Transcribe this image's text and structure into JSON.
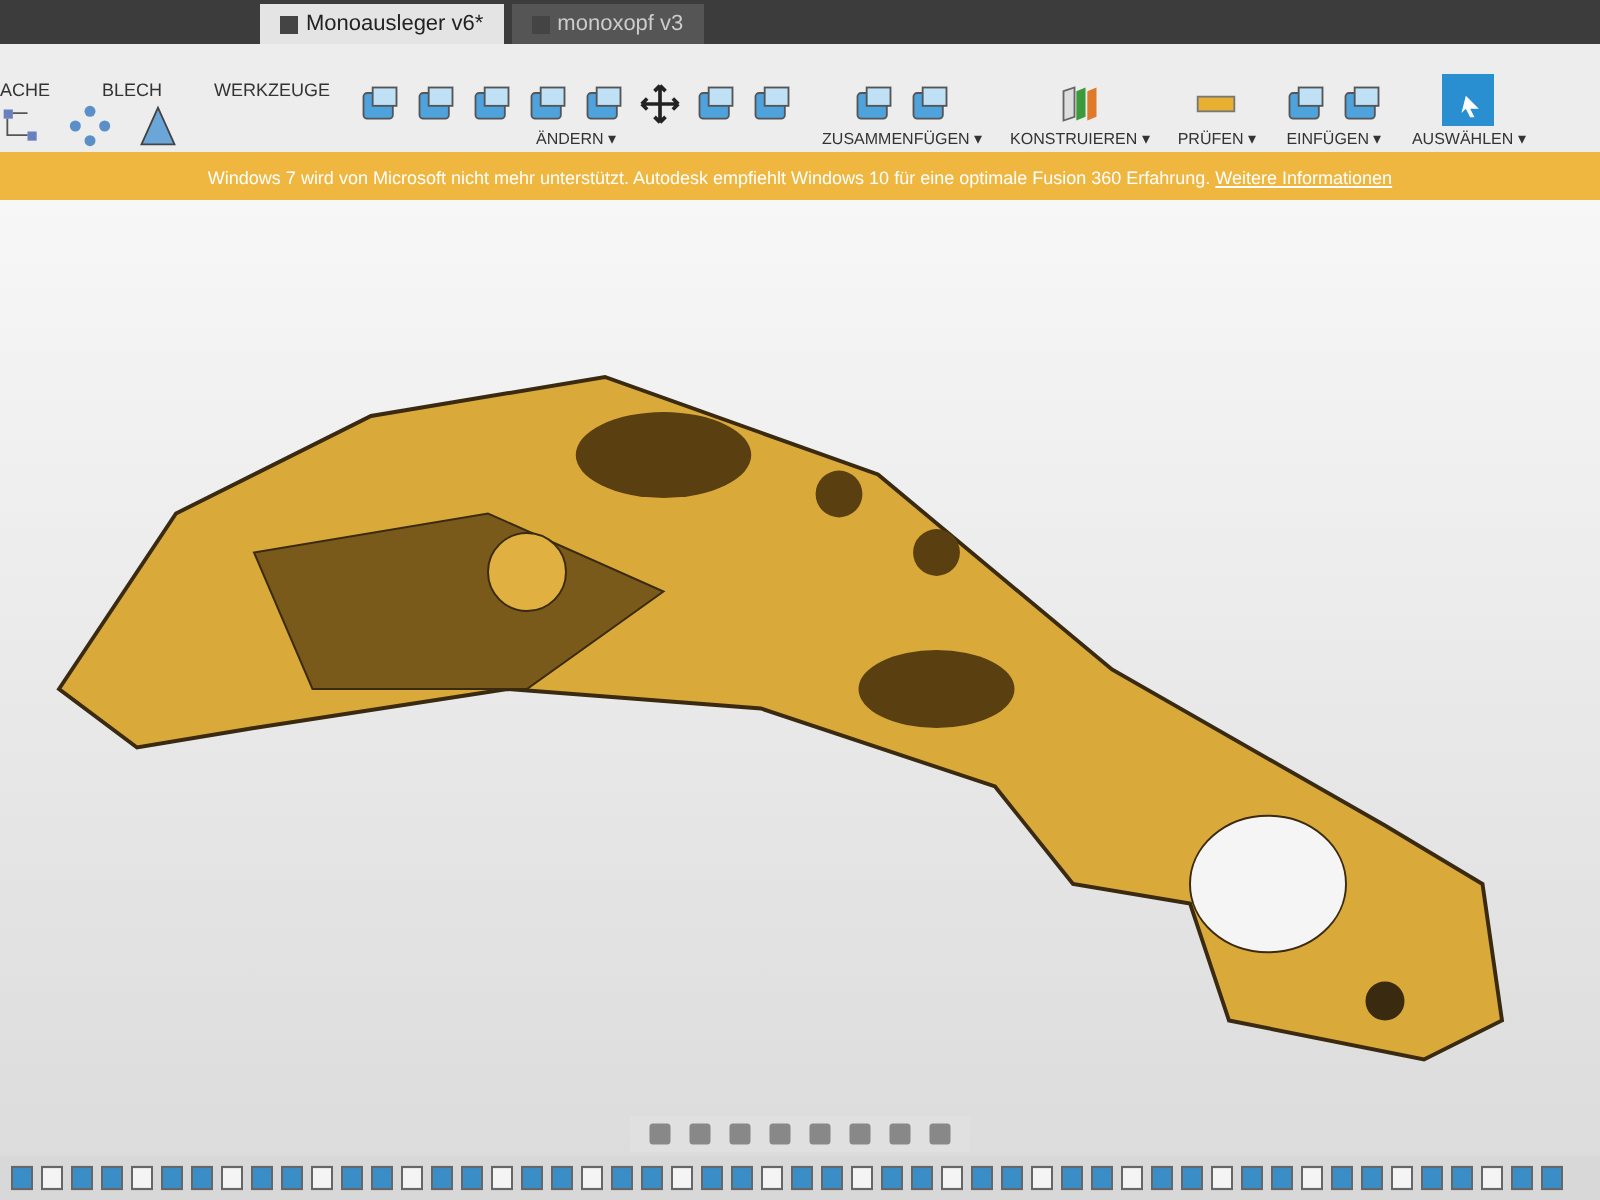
{
  "documents": [
    {
      "title": "Monoausleger v6*",
      "selected": true
    },
    {
      "title": "monoxopf v3",
      "selected": false
    }
  ],
  "workspace_tabs": [
    {
      "label": "ACHE"
    },
    {
      "label": "BLECH"
    },
    {
      "label": "WERKZEUGE"
    }
  ],
  "toolbar": {
    "groups": [
      {
        "label": "ÄNDERN ▾"
      },
      {
        "label": "ZUSAMMENFÜGEN ▾"
      },
      {
        "label": "KONSTRUIEREN ▾"
      },
      {
        "label": "PRÜFEN ▾"
      },
      {
        "label": "EINFÜGEN ▾"
      },
      {
        "label": "AUSWÄHLEN ▾"
      }
    ]
  },
  "banner": {
    "text": "Windows 7 wird von Microsoft nicht mehr unterstützt. Autodesk empfiehlt Windows 10 für eine optimale Fusion 360 Erfahrung.",
    "link": "Weitere Informationen"
  }
}
